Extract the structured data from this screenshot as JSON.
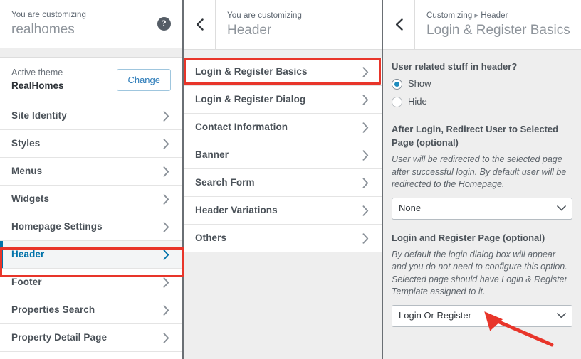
{
  "sidebar": {
    "header": {
      "eyebrow": "You are customizing",
      "title": "realhomes",
      "help_icon": "help-circle-icon"
    },
    "theme": {
      "label": "Active theme",
      "name": "RealHomes",
      "change_label": "Change"
    },
    "items": [
      {
        "label": "Site Identity",
        "active": false
      },
      {
        "label": "Styles",
        "active": false
      },
      {
        "label": "Menus",
        "active": false
      },
      {
        "label": "Widgets",
        "active": false
      },
      {
        "label": "Homepage Settings",
        "active": false
      },
      {
        "label": "Header",
        "active": true
      },
      {
        "label": "Footer",
        "active": false
      },
      {
        "label": "Properties Search",
        "active": false
      },
      {
        "label": "Property Detail Page",
        "active": false
      }
    ]
  },
  "middle": {
    "header": {
      "back_icon": "chevron-left-icon",
      "eyebrow": "You are customizing",
      "title": "Header"
    },
    "items": [
      {
        "label": "Login & Register Basics"
      },
      {
        "label": "Login & Register Dialog"
      },
      {
        "label": "Contact Information"
      },
      {
        "label": "Banner"
      },
      {
        "label": "Search Form"
      },
      {
        "label": "Header Variations"
      },
      {
        "label": "Others"
      }
    ]
  },
  "right": {
    "header": {
      "back_icon": "chevron-left-icon",
      "eyebrow_prefix": "Customizing",
      "eyebrow_suffix": "Header",
      "title": "Login & Register Basics"
    },
    "controls": {
      "user_related": {
        "label": "User related stuff in header?",
        "options": [
          {
            "label": "Show",
            "checked": true
          },
          {
            "label": "Hide",
            "checked": false
          }
        ]
      },
      "redirect": {
        "label": "After Login, Redirect User to Selected Page (optional)",
        "description": "User will be redirected to the selected page after successful login. By default user will be redirected to the Homepage.",
        "value": "None"
      },
      "login_page": {
        "label": "Login and Register Page (optional)",
        "description": "By default the login dialog box will appear and you do not need to configure this option. Selected page should have Login & Register Template assigned to it.",
        "value": "Login Or Register"
      }
    }
  },
  "colors": {
    "accent_blue": "#0073aa",
    "annotation_red": "#e8352a",
    "panel_bg": "#eeeeee",
    "text_dark": "#4a5158"
  },
  "annotations": [
    {
      "name": "highlight-header-menu-item",
      "type": "rect"
    },
    {
      "name": "highlight-login-register-basics",
      "type": "rect"
    },
    {
      "name": "pointer-to-login-page-select",
      "type": "arrow"
    }
  ]
}
